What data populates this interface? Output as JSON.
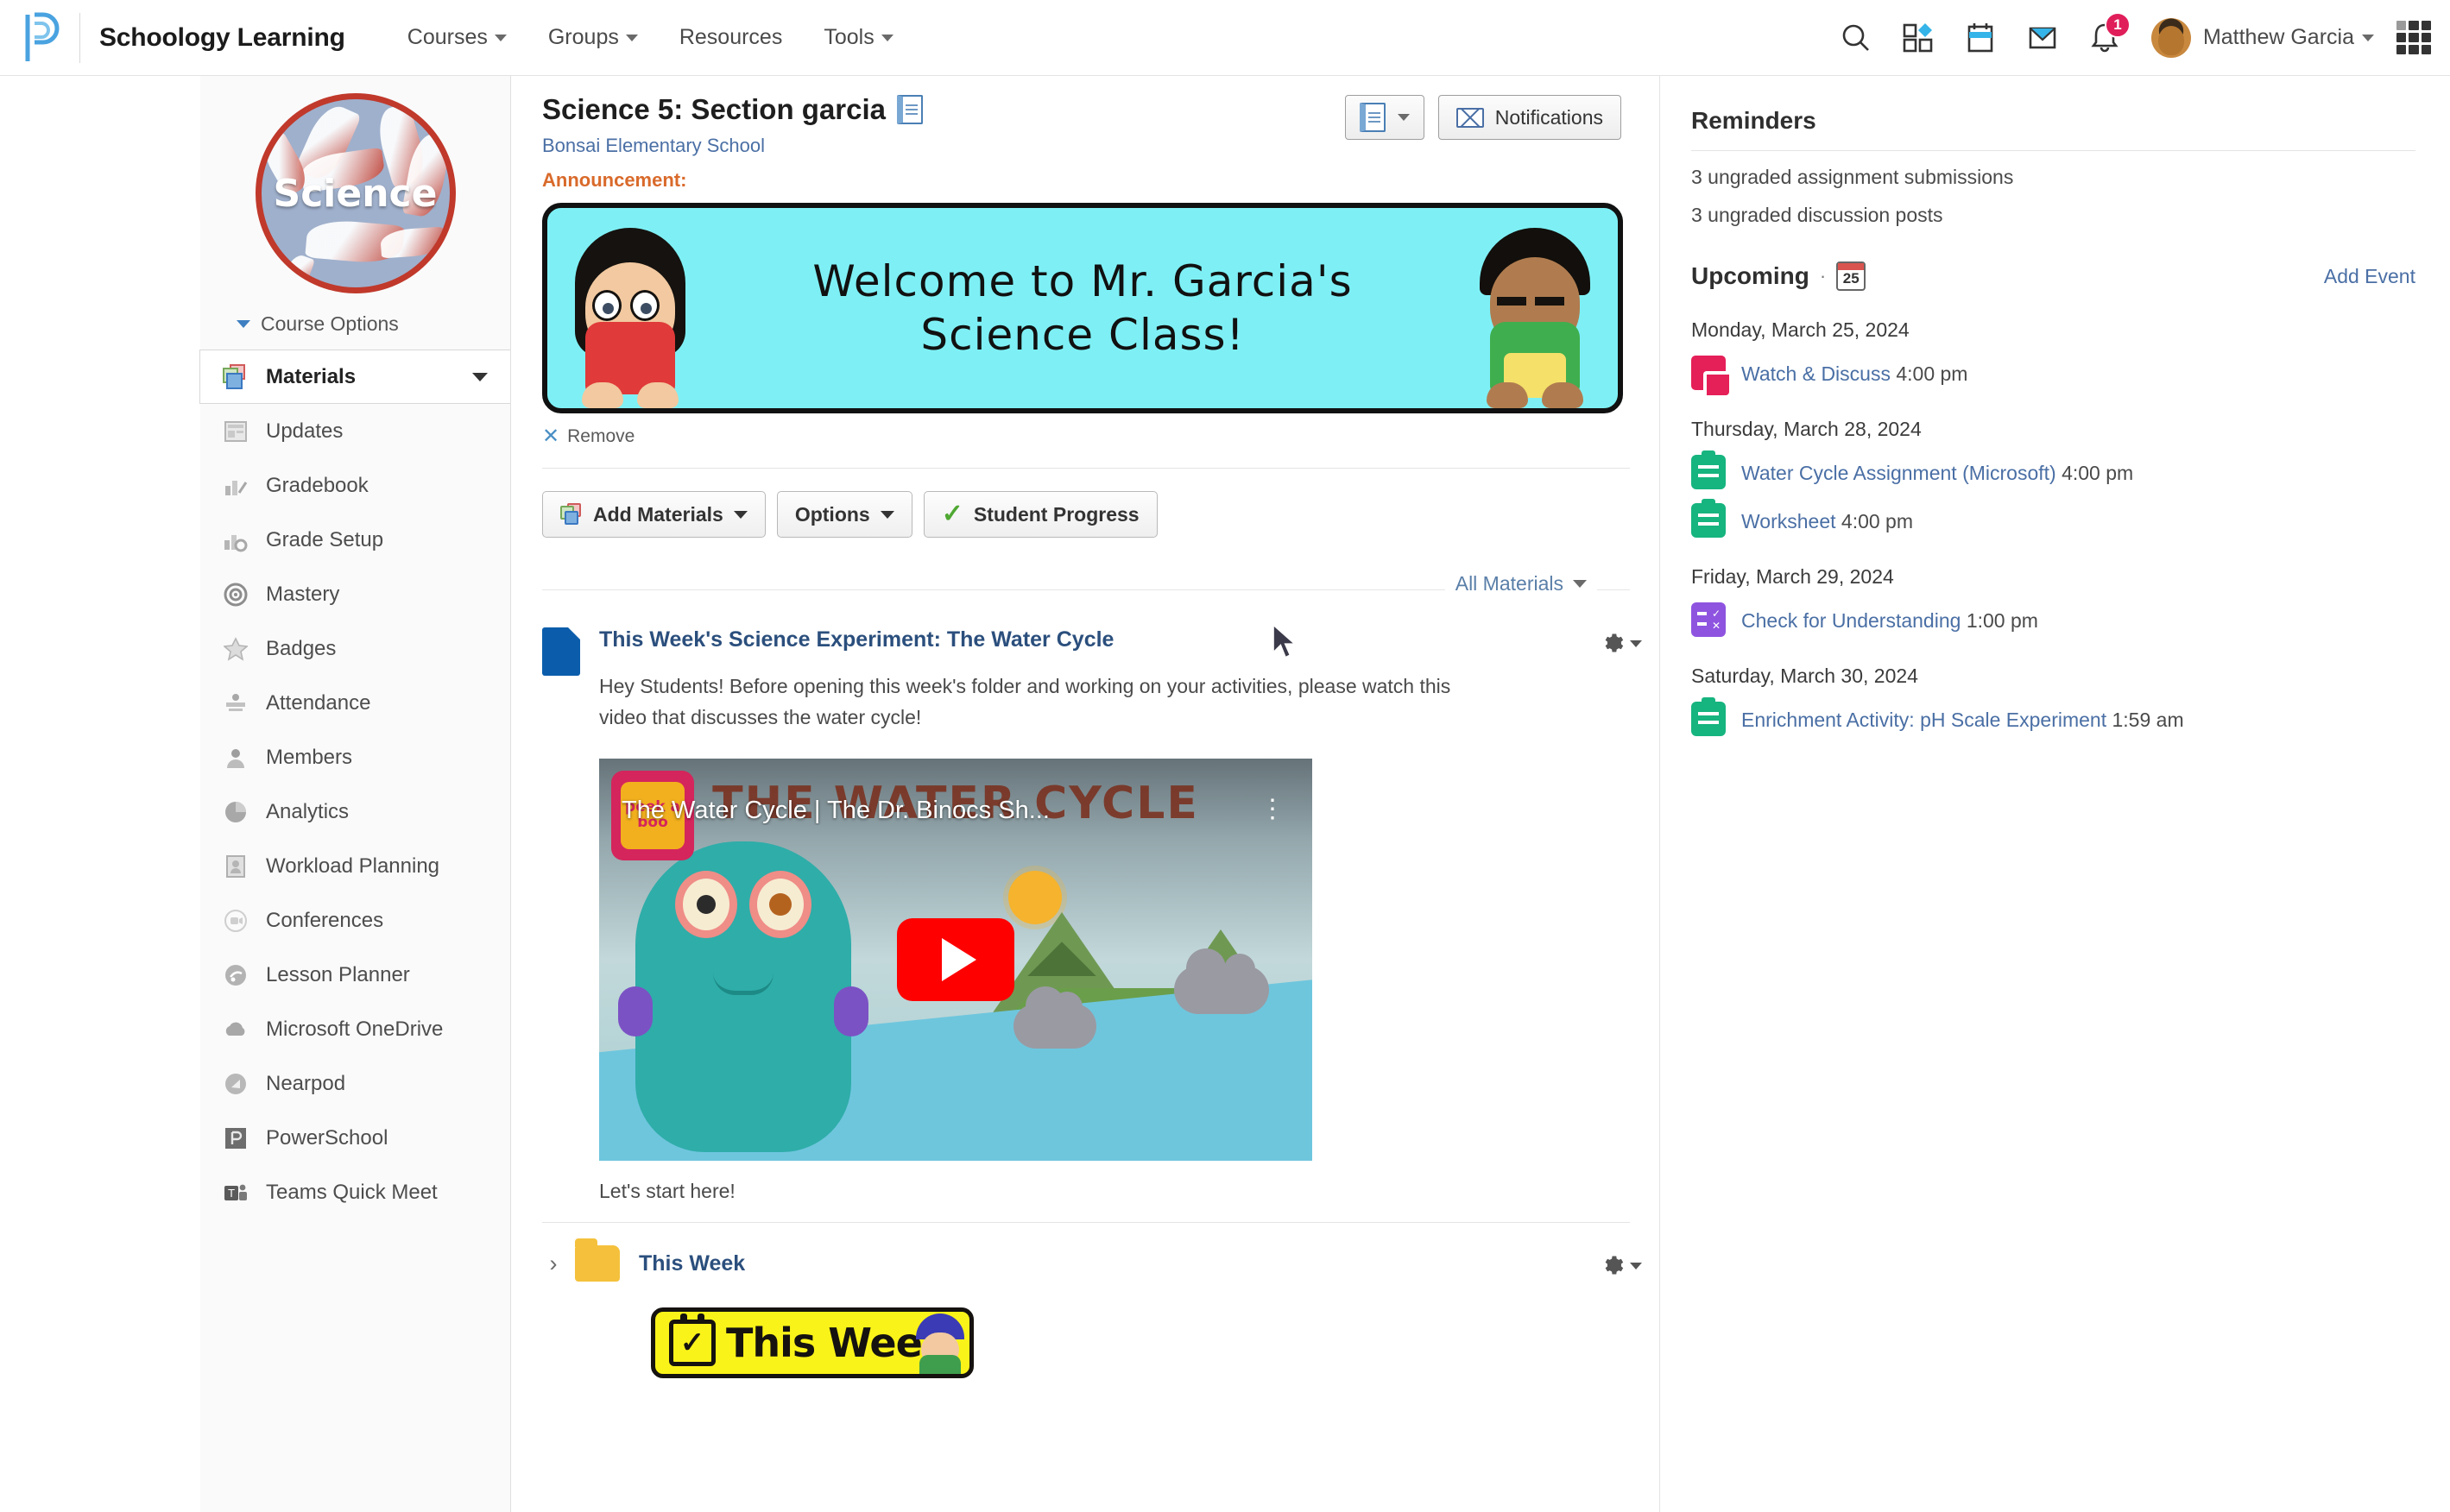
{
  "topbar": {
    "brand": "Schoology Learning",
    "nav": [
      {
        "label": "Courses",
        "caret": true
      },
      {
        "label": "Groups",
        "caret": true
      },
      {
        "label": "Resources",
        "caret": false
      },
      {
        "label": "Tools",
        "caret": true
      }
    ],
    "icons": [
      "search-icon",
      "apps-icon",
      "calendar-icon",
      "mail-icon",
      "bell-icon"
    ],
    "notification_count": "1",
    "user_name": "Matthew Garcia"
  },
  "sidebar": {
    "course_image_label": "Science",
    "course_options": "Course Options",
    "items": [
      {
        "label": "Materials",
        "icon": "materials-icon",
        "active": true
      },
      {
        "label": "Updates",
        "icon": "updates-icon",
        "active": false
      },
      {
        "label": "Gradebook",
        "icon": "gradebook-icon",
        "active": false
      },
      {
        "label": "Grade Setup",
        "icon": "grade-setup-icon",
        "active": false
      },
      {
        "label": "Mastery",
        "icon": "mastery-icon",
        "active": false
      },
      {
        "label": "Badges",
        "icon": "badge-star-icon",
        "active": false
      },
      {
        "label": "Attendance",
        "icon": "attendance-icon",
        "active": false
      },
      {
        "label": "Members",
        "icon": "members-icon",
        "active": false
      },
      {
        "label": "Analytics",
        "icon": "analytics-pie-icon",
        "active": false
      },
      {
        "label": "Workload Planning",
        "icon": "workload-planning-icon",
        "active": false
      },
      {
        "label": "Conferences",
        "icon": "conferences-icon",
        "active": false
      },
      {
        "label": "Lesson Planner",
        "icon": "lesson-planner-icon",
        "active": false
      },
      {
        "label": "Microsoft OneDrive",
        "icon": "cloud-icon",
        "active": false
      },
      {
        "label": "Nearpod",
        "icon": "nearpod-icon",
        "active": false
      },
      {
        "label": "PowerSchool",
        "icon": "powerschool-icon",
        "active": false
      },
      {
        "label": "Teams Quick Meet",
        "icon": "teams-icon",
        "active": false
      }
    ]
  },
  "header": {
    "course_title": "Science 5: Section garcia",
    "school": "Bonsai Elementary School",
    "announcement_label": "Announcement:",
    "notifications_button": "Notifications"
  },
  "banner": {
    "line1": "Welcome to Mr. Garcia's",
    "line2": "Science Class!",
    "remove_label": "Remove"
  },
  "toolbar": {
    "add_materials": "Add Materials",
    "options": "Options",
    "student_progress": "Student Progress",
    "filter": "All Materials"
  },
  "materials": [
    {
      "title": "This Week's Science Experiment: The Water Cycle",
      "body": "Hey Students! Before opening this week's folder and working on your activities, please watch this video that discusses the water cycle!",
      "video_title": "The Water Cycle | The Dr. Binocs Sh...",
      "video_headline": "THE WATER CYCLE",
      "video_brand": "peek a boo",
      "caption": "Let's start here!"
    },
    {
      "title": "This Week",
      "week_banner_text": "This Week"
    }
  ],
  "rail": {
    "reminders_title": "Reminders",
    "reminders": [
      "3 ungraded assignment submissions",
      "3 ungraded discussion posts"
    ],
    "upcoming_title": "Upcoming",
    "upcoming_badge": "25",
    "add_event": "Add Event",
    "events": [
      {
        "date": "Monday, March 25, 2024",
        "items": [
          {
            "name": "Watch & Discuss",
            "time": "4:00 pm",
            "type": "discussion"
          }
        ]
      },
      {
        "date": "Thursday, March 28, 2024",
        "items": [
          {
            "name": "Water Cycle Assignment (Microsoft)",
            "time": "4:00 pm",
            "type": "assignment"
          },
          {
            "name": "Worksheet",
            "time": "4:00 pm",
            "type": "assignment"
          }
        ]
      },
      {
        "date": "Friday, March 29, 2024",
        "items": [
          {
            "name": "Check for Understanding",
            "time": "1:00 pm",
            "type": "quiz"
          }
        ]
      },
      {
        "date": "Saturday, March 30, 2024",
        "items": [
          {
            "name": "Enrichment Activity: pH Scale Experiment",
            "time": "1:59 am",
            "type": "assignment"
          }
        ]
      }
    ]
  },
  "colors": {
    "brand_blue": "#4aa3e0",
    "accent_orange": "#d96a2b",
    "link_blue": "#4a6fa5",
    "banner_cyan": "#7ef0f5",
    "notif_red": "#e01e5a",
    "assignment_green": "#16b47f",
    "discussion_pink": "#e51f58",
    "quiz_purple": "#8e54e0",
    "folder_yellow": "#f5c13c"
  }
}
